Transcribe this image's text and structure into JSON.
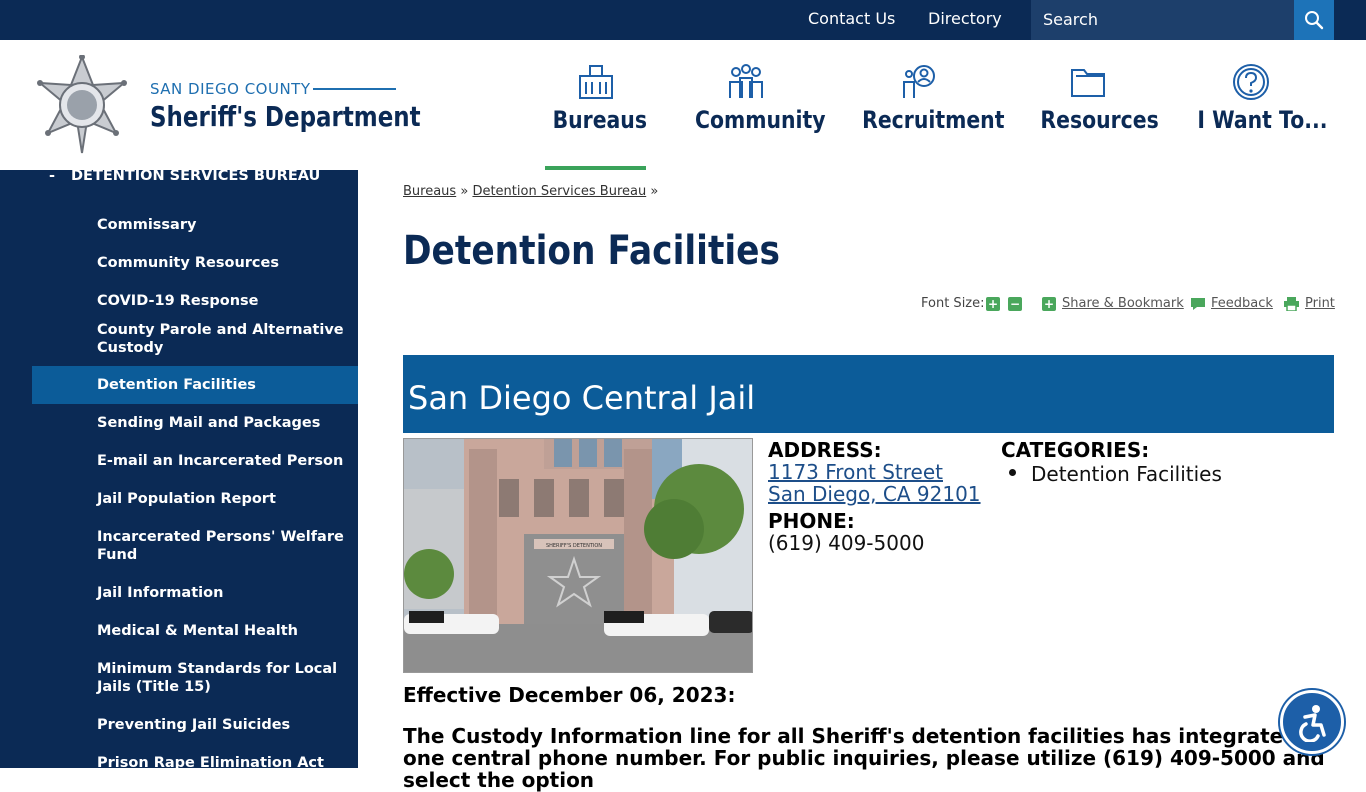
{
  "topbar": {
    "contact": "Contact Us",
    "directory": "Directory",
    "search_placeholder": "Search"
  },
  "header": {
    "brand_top": "SAN DIEGO COUNTY",
    "brand_main": "Sheriff's Department",
    "nav": [
      {
        "label": "Bureaus",
        "icon": "building-icon",
        "active": true
      },
      {
        "label": "Community",
        "icon": "people-icon",
        "active": false
      },
      {
        "label": "Recruitment",
        "icon": "recruit-icon",
        "active": false
      },
      {
        "label": "Resources",
        "icon": "folder-icon",
        "active": false
      },
      {
        "label": "I Want To...",
        "icon": "question-icon",
        "active": false
      }
    ]
  },
  "sidebar": {
    "section": "DETENTION SERVICES BUREAU",
    "section_marker": "-",
    "items": [
      {
        "label": "Commissary"
      },
      {
        "label": "Community Resources"
      },
      {
        "label": "COVID-19 Response"
      },
      {
        "label": "County Parole and Alternative Custody"
      },
      {
        "label": "Detention Facilities",
        "active": true
      },
      {
        "label": "Sending Mail and Packages"
      },
      {
        "label": "E-mail an Incarcerated Person"
      },
      {
        "label": "Jail Population Report"
      },
      {
        "label": "Incarcerated Persons' Welfare Fund"
      },
      {
        "label": "Jail Information"
      },
      {
        "label": "Medical & Mental Health"
      },
      {
        "label": "Minimum Standards for Local Jails (Title 15)"
      },
      {
        "label": "Preventing Jail Suicides"
      },
      {
        "label": "Prison Rape Elimination Act"
      }
    ]
  },
  "breadcrumb": {
    "items": [
      "Bureaus",
      "Detention Services Bureau"
    ],
    "separator": "»"
  },
  "page": {
    "title": "Detention Facilities",
    "font_size_label": "Font Size:",
    "increase": "+",
    "decrease": "−",
    "share": "Share & Bookmark",
    "feedback": "Feedback",
    "print": "Print"
  },
  "facility": {
    "name": "San Diego Central Jail",
    "address_label": "ADDRESS:",
    "address_line1": "1173 Front Street",
    "address_line2": "San Diego, CA 92101",
    "phone_label": "PHONE:",
    "phone": "(619) 409-5000",
    "categories_label": "CATEGORIES:",
    "category": "Detention Facilities",
    "sign_text": "SHERIFF'S DETENTION"
  },
  "notice": {
    "effective": "Effective December 06, 2023:",
    "text": "The Custody Information line for all Sheriff's detention facilities has integrated to one central phone number. For public inquiries, please utilize (619) 409-5000 and select the option"
  },
  "colors": {
    "navy": "#0b2a55",
    "blue": "#0c5c99",
    "green": "#3aa35a",
    "link": "#1d4e89"
  }
}
